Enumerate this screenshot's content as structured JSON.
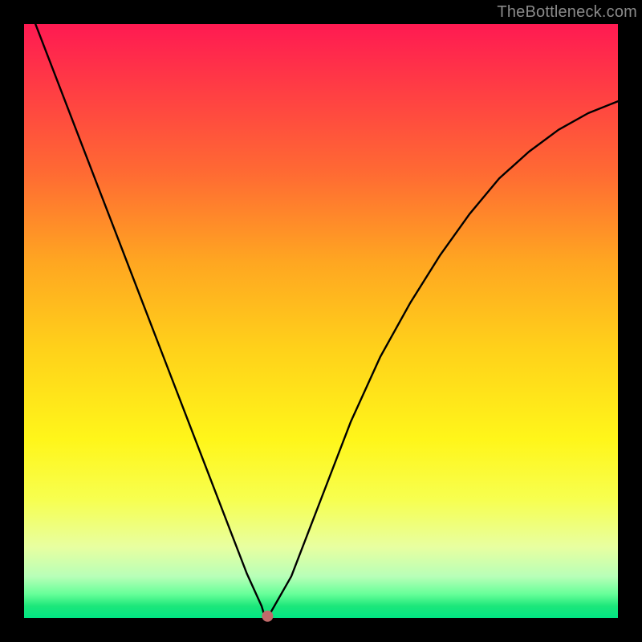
{
  "watermark": "TheBottleneck.com",
  "chart_data": {
    "type": "line",
    "title": "",
    "xlabel": "",
    "ylabel": "",
    "xlim": [
      0,
      1
    ],
    "ylim": [
      0,
      1
    ],
    "grid": false,
    "legend": false,
    "series": [
      {
        "name": "curve",
        "x": [
          0.0,
          0.05,
          0.1,
          0.15,
          0.2,
          0.25,
          0.3,
          0.35,
          0.375,
          0.4,
          0.405,
          0.41,
          0.45,
          0.5,
          0.55,
          0.6,
          0.65,
          0.7,
          0.75,
          0.8,
          0.85,
          0.9,
          0.95,
          1.0
        ],
        "y": [
          1.05,
          0.92,
          0.79,
          0.66,
          0.53,
          0.4,
          0.27,
          0.14,
          0.075,
          0.02,
          0.003,
          0.0,
          0.07,
          0.2,
          0.33,
          0.44,
          0.53,
          0.61,
          0.68,
          0.74,
          0.785,
          0.822,
          0.85,
          0.87
        ]
      }
    ],
    "marker": {
      "x": 0.41,
      "y": 0.003
    },
    "gradient_colors_top_to_bottom": [
      "#ff1a52",
      "#ff6a33",
      "#ffd21a",
      "#f7ff4f",
      "#66ff99",
      "#00e583"
    ]
  }
}
